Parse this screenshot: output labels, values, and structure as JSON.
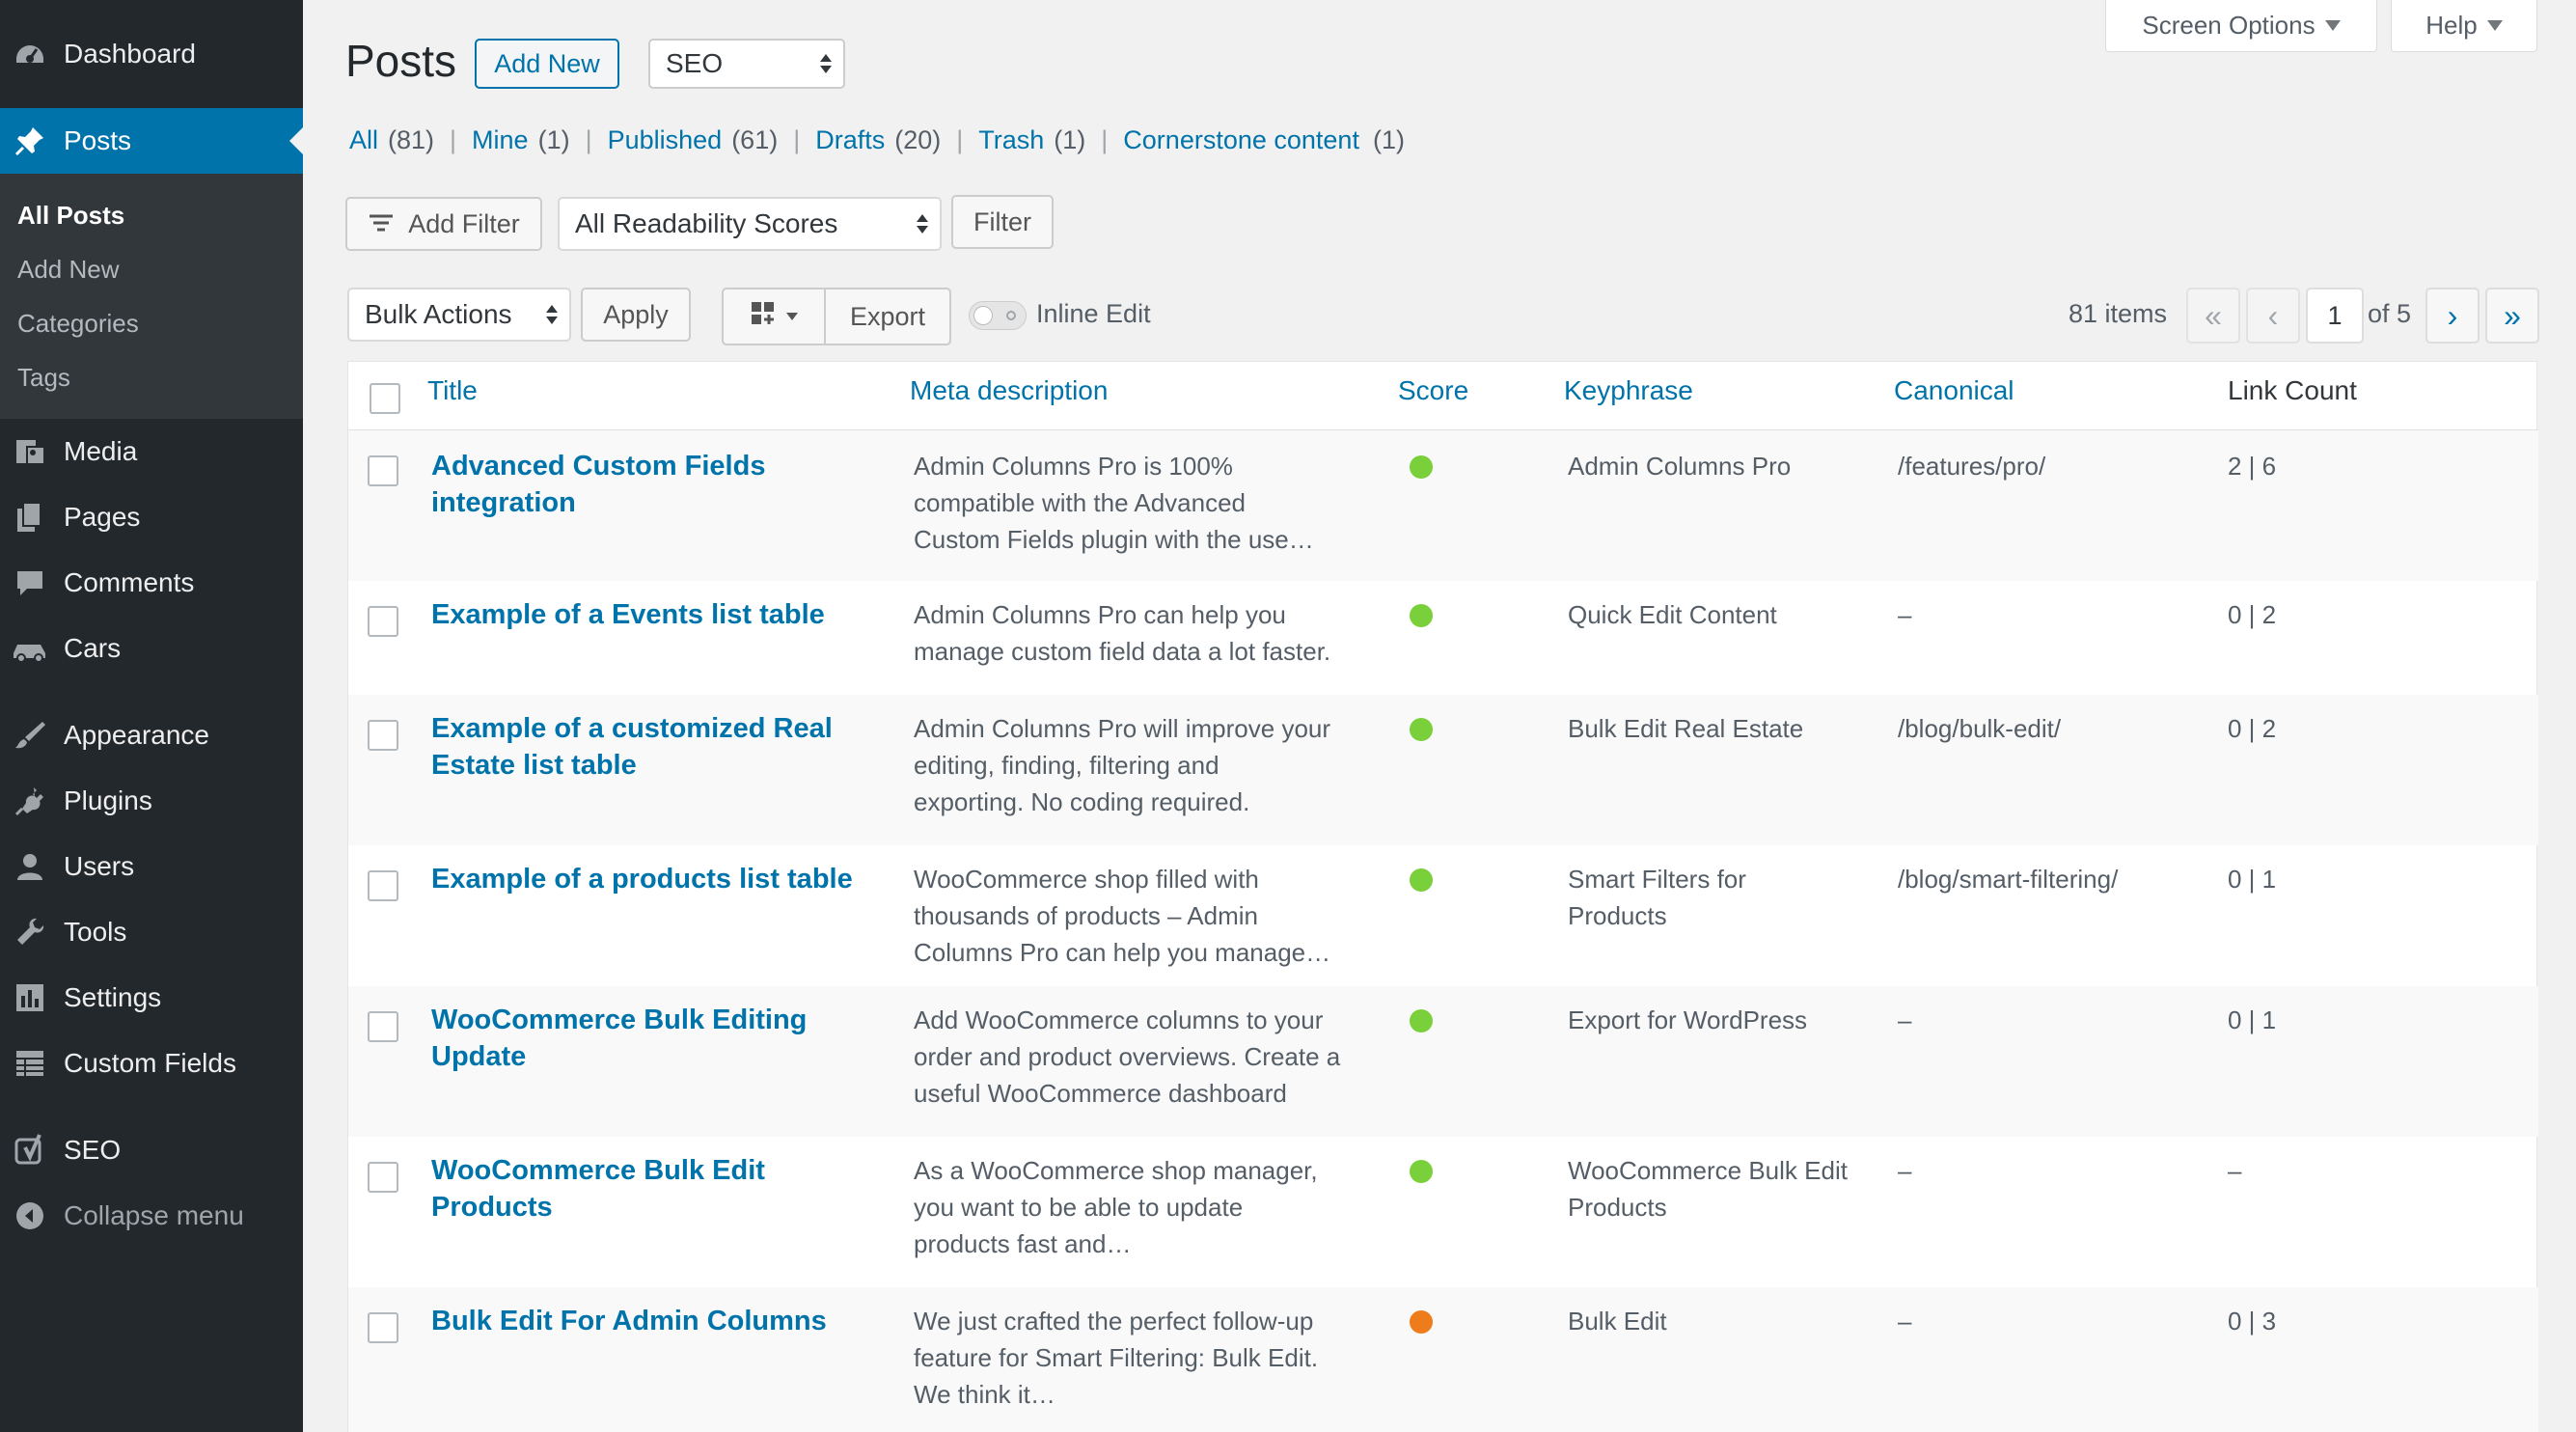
{
  "sidebar": {
    "menu": [
      {
        "label": "Dashboard",
        "icon": "dashboard-icon"
      },
      {
        "label": "Posts",
        "icon": "pin-icon",
        "current": true
      },
      {
        "label": "Media",
        "icon": "media-icon"
      },
      {
        "label": "Pages",
        "icon": "pages-icon"
      },
      {
        "label": "Comments",
        "icon": "comments-icon"
      },
      {
        "label": "Cars",
        "icon": "car-icon"
      },
      {
        "label": "Appearance",
        "icon": "brush-icon"
      },
      {
        "label": "Plugins",
        "icon": "plug-icon"
      },
      {
        "label": "Users",
        "icon": "user-icon"
      },
      {
        "label": "Tools",
        "icon": "wrench-icon"
      },
      {
        "label": "Settings",
        "icon": "settings-icon"
      },
      {
        "label": "Custom Fields",
        "icon": "table-icon"
      },
      {
        "label": "SEO",
        "icon": "yoast-icon"
      },
      {
        "label": "Collapse menu",
        "icon": "collapse-icon"
      }
    ],
    "submenu": [
      "All Posts",
      "Add New",
      "Categories",
      "Tags"
    ]
  },
  "screen_meta": {
    "screen_options": "Screen Options",
    "help": "Help"
  },
  "header": {
    "title": "Posts",
    "add_new": "Add New",
    "list_screen": "SEO"
  },
  "views": [
    {
      "label": "All",
      "count": "(81)"
    },
    {
      "label": "Mine",
      "count": "(1)"
    },
    {
      "label": "Published",
      "count": "(61)"
    },
    {
      "label": "Drafts",
      "count": "(20)"
    },
    {
      "label": "Trash",
      "count": "(1)"
    },
    {
      "label": "Cornerstone content",
      "count": "(1)"
    }
  ],
  "filters": {
    "add_filter": "Add Filter",
    "readability": "All Readability Scores",
    "filter_button": "Filter"
  },
  "tablenav": {
    "bulk_actions": "Bulk Actions",
    "apply": "Apply",
    "export": "Export",
    "inline_edit": "Inline Edit",
    "items": "81 items",
    "first": "«",
    "prev": "‹",
    "page": "1",
    "of": "of 5",
    "next": "›",
    "last": "»"
  },
  "columns": [
    "Title",
    "Meta description",
    "Score",
    "Keyphrase",
    "Canonical",
    "Link Count"
  ],
  "colors": {
    "accent": "#0073aa",
    "sidebar": "#23282d",
    "score_good": "#7ad03a",
    "score_ok": "#ee7c1b"
  },
  "rows": [
    {
      "title": [
        "Advanced Custom Fields",
        "integration"
      ],
      "meta": [
        "Admin Columns Pro is 100%",
        "compatible with the Advanced",
        "Custom Fields plugin with the use…"
      ],
      "score": "good",
      "keyphrase": [
        "Admin Columns Pro"
      ],
      "canonical": "/features/pro/",
      "links": "2 | 6"
    },
    {
      "title": [
        "Example of a Events list table"
      ],
      "meta": [
        "Admin Columns Pro can help you",
        "manage custom field data a lot faster."
      ],
      "score": "good",
      "keyphrase": [
        "Quick Edit Content"
      ],
      "canonical": "–",
      "links": "0 | 2"
    },
    {
      "title": [
        "Example of a customized Real",
        "Estate list table"
      ],
      "meta": [
        "Admin Columns Pro will improve your",
        "editing, finding, filtering and",
        "exporting. No coding required."
      ],
      "score": "good",
      "keyphrase": [
        "Bulk Edit Real Estate"
      ],
      "canonical": "/blog/bulk-edit/",
      "links": "0 | 2"
    },
    {
      "title": [
        "Example of a products list table"
      ],
      "meta": [
        "WooCommerce shop filled with",
        "thousands of products – Admin",
        "Columns Pro can help you manage…"
      ],
      "score": "good",
      "keyphrase": [
        "Smart Filters for",
        "Products"
      ],
      "canonical": "/blog/smart-filtering/",
      "links": "0 | 1"
    },
    {
      "title": [
        "WooCommerce Bulk Editing",
        "Update"
      ],
      "meta": [
        "Add WooCommerce columns to your",
        "order and product overviews. Create a",
        "useful WooCommerce dashboard"
      ],
      "score": "good",
      "keyphrase": [
        "Export for WordPress"
      ],
      "canonical": "–",
      "links": "0 | 1"
    },
    {
      "title": [
        "WooCommerce Bulk Edit",
        "Products"
      ],
      "meta": [
        "As a WooCommerce shop manager,",
        "you want to be able to update",
        "products fast and…"
      ],
      "score": "good",
      "keyphrase": [
        "WooCommerce Bulk Edit",
        "Products"
      ],
      "canonical": "–",
      "links": "–"
    },
    {
      "title": [
        "Bulk Edit For Admin Columns"
      ],
      "meta": [
        "We just crafted the perfect follow-up",
        "feature for Smart Filtering: Bulk Edit.",
        "We think it…"
      ],
      "score": "ok",
      "keyphrase": [
        "Bulk Edit"
      ],
      "canonical": "–",
      "links": "0 | 3"
    }
  ]
}
